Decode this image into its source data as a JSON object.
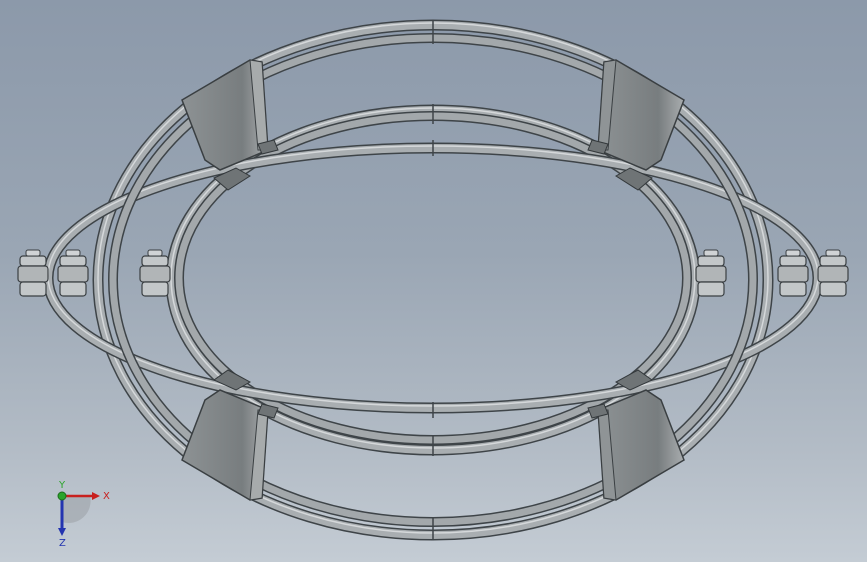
{
  "viewport": {
    "background_top": "#8c99aa",
    "background_bottom": "#c4ccd4"
  },
  "model": {
    "tube_color": "#a3a8ab",
    "tube_edge": "#3e4448",
    "bracket_color": "#7f8486",
    "bracket_highlight": "#a7abac"
  },
  "triad": {
    "x_label": "X",
    "y_label": "Y",
    "z_label": "Z",
    "x_color": "#c8201e",
    "y_color": "#2ba42b",
    "z_color": "#2334b0"
  }
}
